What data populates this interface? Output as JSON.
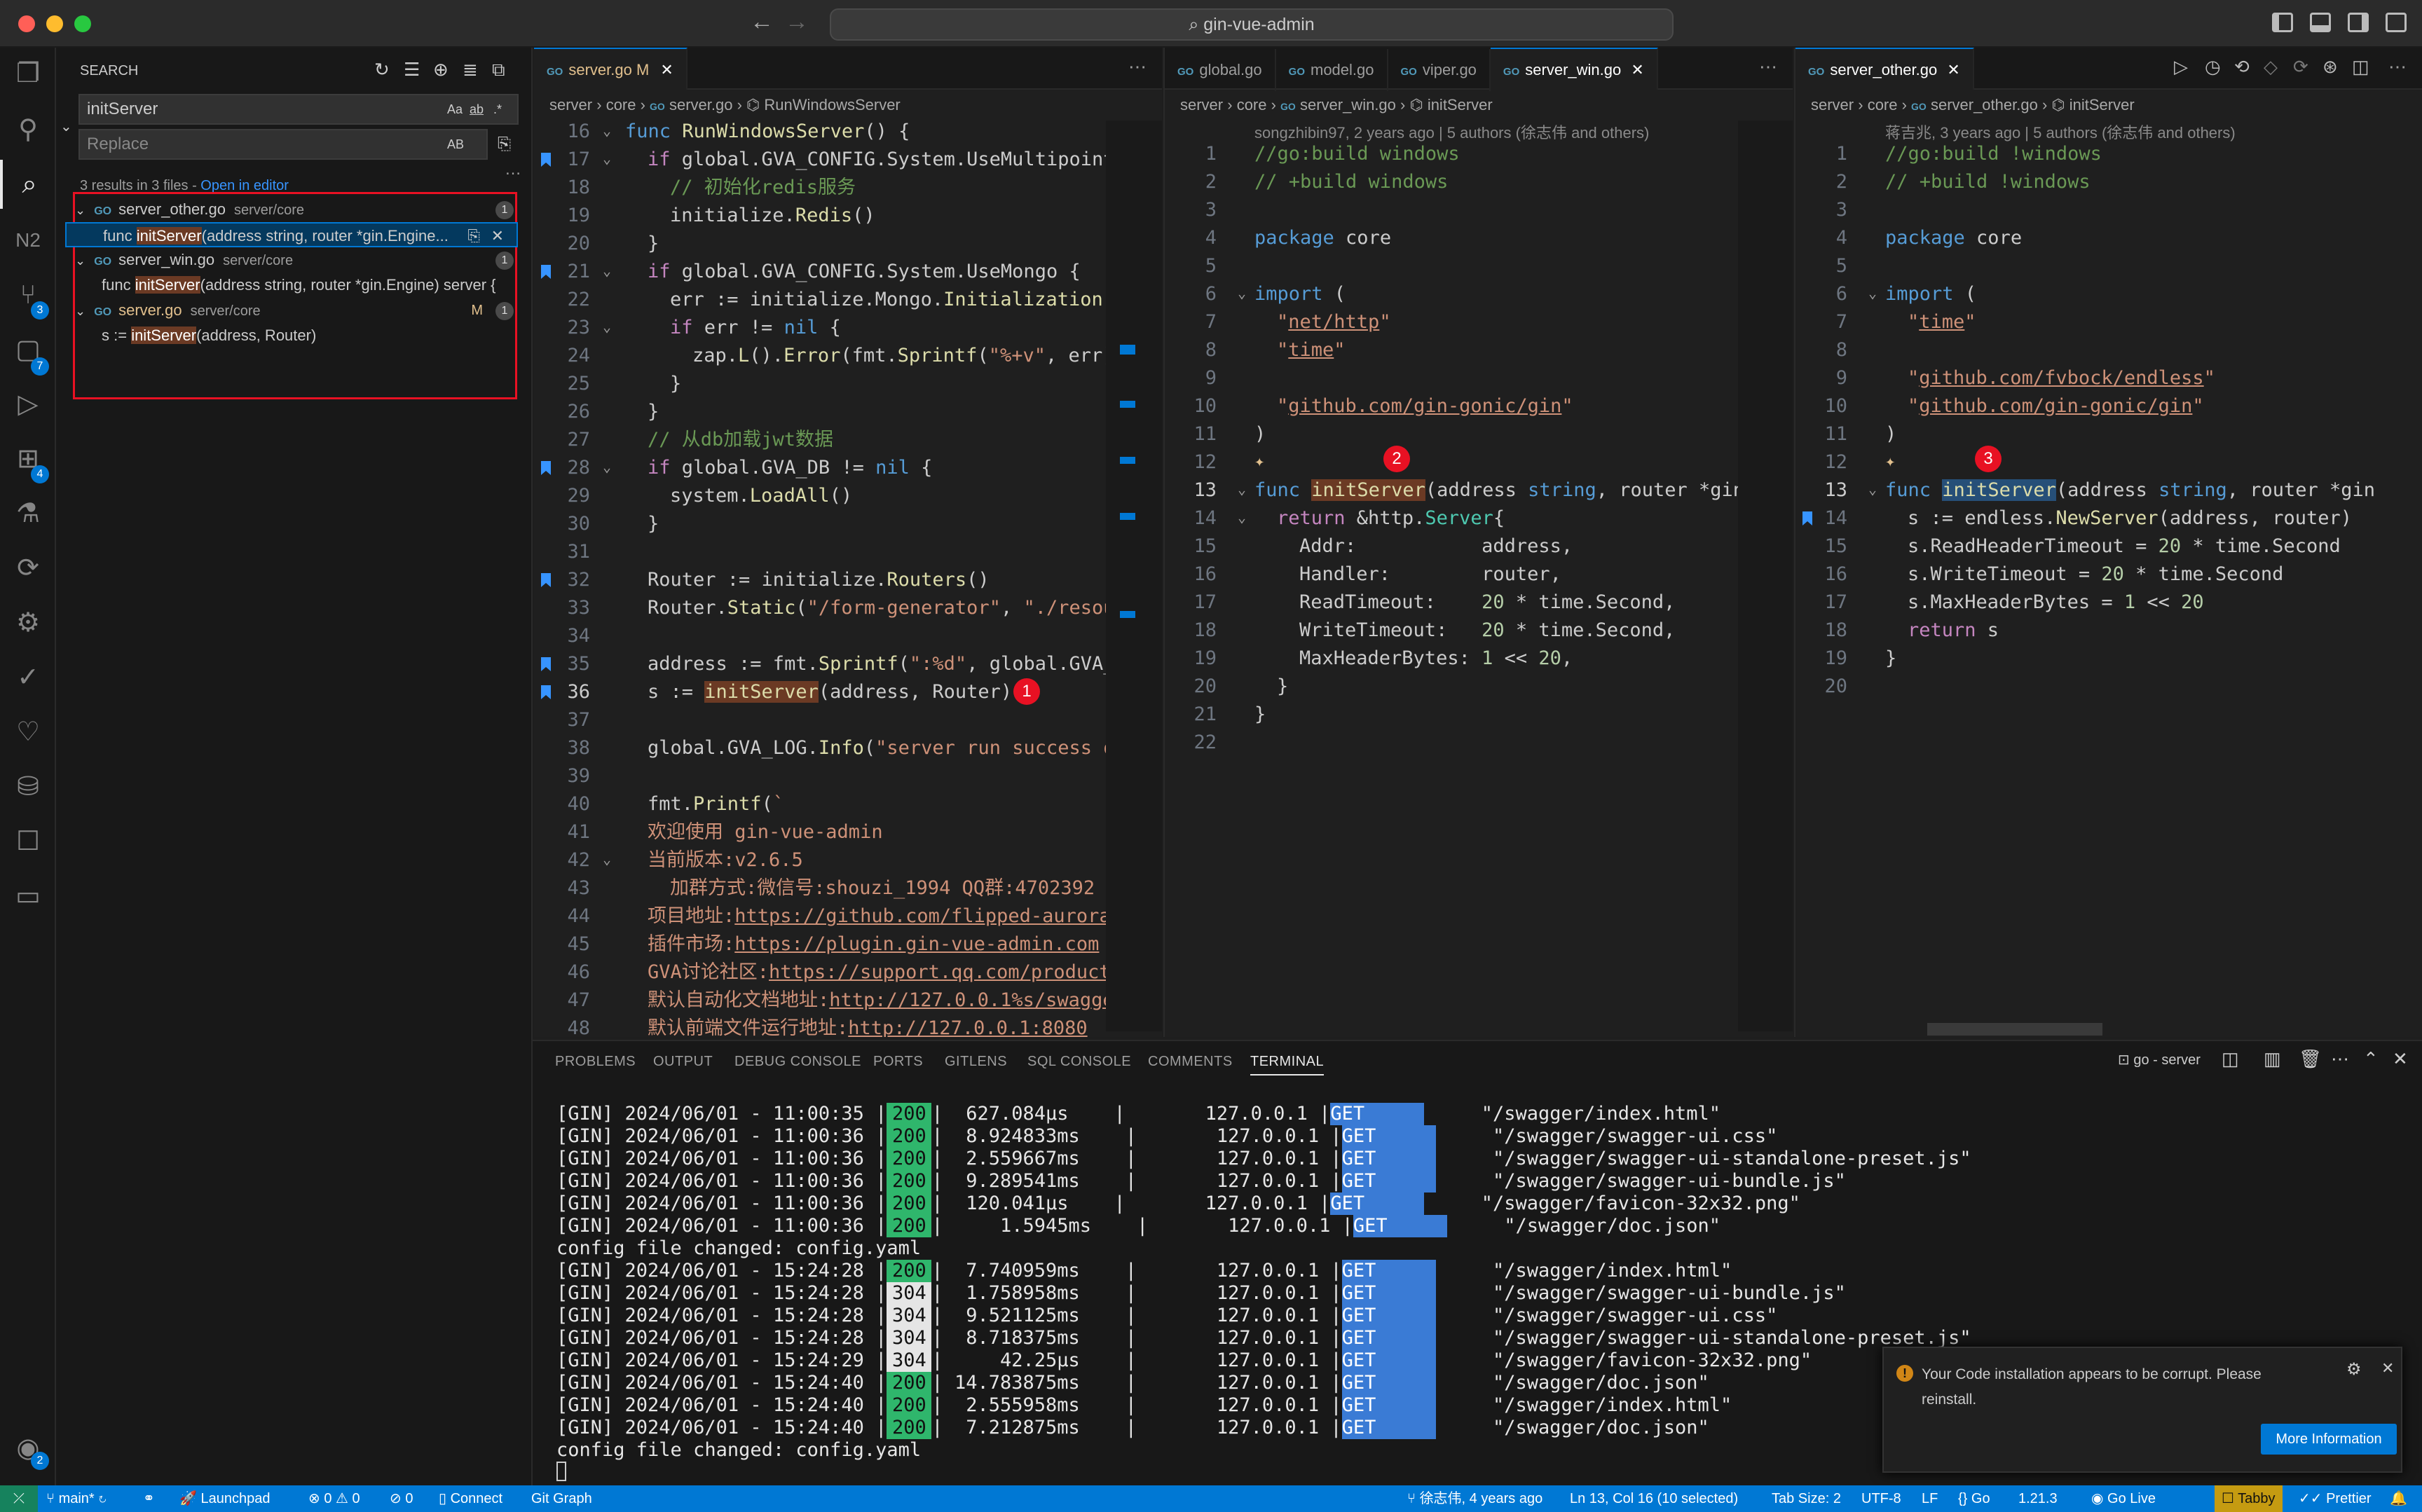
{
  "window": {
    "title": "gin-vue-admin"
  },
  "activity_badges": {
    "scm": "3",
    "run": "7",
    "ext": "4",
    "accounts": "2"
  },
  "search": {
    "header": "SEARCH",
    "query": "initServer",
    "replace_placeholder": "Replace",
    "case_opt": "Aa",
    "word_opt": "ab",
    "regex_opt": ".*",
    "preserve_case": "AB",
    "summary": "3 results in 3 files - ",
    "open_in_editor": "Open in editor",
    "files": [
      {
        "name": "server_other.go",
        "path": "server/core",
        "count": "1",
        "match_pre": "func ",
        "match": "initServer",
        "match_post": "(address string, router *gin.Engine..."
      },
      {
        "name": "server_win.go",
        "path": "server/core",
        "count": "1",
        "match_pre": "func ",
        "match": "initServer",
        "match_post": "(address string, router *gin.Engine) server {"
      },
      {
        "name": "server.go",
        "path": "server/core",
        "count": "1",
        "modified": "M",
        "match_pre": "s := ",
        "match": "initServer",
        "match_post": "(address, Router)"
      }
    ]
  },
  "editor1": {
    "tab": "server.go",
    "tab_badge": "M",
    "crumbs": [
      "server",
      "core",
      "server.go",
      "RunWindowsServer"
    ],
    "marker": "1"
  },
  "editor2": {
    "tabs": [
      "global.go",
      "model.go",
      "viper.go",
      "server_win.go"
    ],
    "crumbs": [
      "server",
      "core",
      "server_win.go",
      "initServer"
    ],
    "blame": "songzhibin97, 2 years ago | 5 authors (徐志伟 and others)",
    "marker": "2"
  },
  "editor3": {
    "tab": "server_other.go",
    "crumbs": [
      "server",
      "core",
      "server_other.go",
      "initServer"
    ],
    "blame": "蒋吉兆, 3 years ago | 5 authors (徐志伟 and others)",
    "marker": "3"
  },
  "panel": {
    "tabs": [
      "PROBLEMS",
      "OUTPUT",
      "DEBUG CONSOLE",
      "PORTS",
      "GITLENS",
      "SQL CONSOLE",
      "COMMENTS",
      "TERMINAL"
    ],
    "terminal_name": "go - server",
    "lines": [
      {
        "t": "[GIN] 2024/06/01 - 11:00:35",
        "s": "200",
        "d": "  627.084µs",
        "ip": "127.0.0.1",
        "m": "GET",
        "p": "\"/swagger/index.html\""
      },
      {
        "t": "[GIN] 2024/06/01 - 11:00:36",
        "s": "200",
        "d": "  8.924833ms",
        "ip": "127.0.0.1",
        "m": "GET",
        "p": "\"/swagger/swagger-ui.css\""
      },
      {
        "t": "[GIN] 2024/06/01 - 11:00:36",
        "s": "200",
        "d": "  2.559667ms",
        "ip": "127.0.0.1",
        "m": "GET",
        "p": "\"/swagger/swagger-ui-standalone-preset.js\""
      },
      {
        "t": "[GIN] 2024/06/01 - 11:00:36",
        "s": "200",
        "d": "  9.289541ms",
        "ip": "127.0.0.1",
        "m": "GET",
        "p": "\"/swagger/swagger-ui-bundle.js\""
      },
      {
        "t": "[GIN] 2024/06/01 - 11:00:36",
        "s": "200",
        "d": "  120.041µs",
        "ip": "127.0.0.1",
        "m": "GET",
        "p": "\"/swagger/favicon-32x32.png\""
      },
      {
        "t": "[GIN] 2024/06/01 - 11:00:36",
        "s": "200",
        "d": "     1.5945ms",
        "ip": "127.0.0.1",
        "m": "GET",
        "p": "\"/swagger/doc.json\""
      },
      {
        "plain": "config file changed: config.yaml"
      },
      {
        "t": "[GIN] 2024/06/01 - 15:24:28",
        "s": "200",
        "d": "  7.740959ms",
        "ip": "127.0.0.1",
        "m": "GET",
        "p": "\"/swagger/index.html\""
      },
      {
        "t": "[GIN] 2024/06/01 - 15:24:28",
        "s": "304",
        "d": "  1.758958ms",
        "ip": "127.0.0.1",
        "m": "GET",
        "p": "\"/swagger/swagger-ui-bundle.js\""
      },
      {
        "t": "[GIN] 2024/06/01 - 15:24:28",
        "s": "304",
        "d": "  9.521125ms",
        "ip": "127.0.0.1",
        "m": "GET",
        "p": "\"/swagger/swagger-ui.css\""
      },
      {
        "t": "[GIN] 2024/06/01 - 15:24:28",
        "s": "304",
        "d": "  8.718375ms",
        "ip": "127.0.0.1",
        "m": "GET",
        "p": "\"/swagger/swagger-ui-standalone-preset.js\""
      },
      {
        "t": "[GIN] 2024/06/01 - 15:24:29",
        "s": "304",
        "d": "     42.25µs",
        "ip": "127.0.0.1",
        "m": "GET",
        "p": "\"/swagger/favicon-32x32.png\""
      },
      {
        "t": "[GIN] 2024/06/01 - 15:24:40",
        "s": "200",
        "d": " 14.783875ms",
        "ip": "127.0.0.1",
        "m": "GET",
        "p": "\"/swagger/doc.json\""
      },
      {
        "t": "[GIN] 2024/06/01 - 15:24:40",
        "s": "200",
        "d": "  2.555958ms",
        "ip": "127.0.0.1",
        "m": "GET",
        "p": "\"/swagger/index.html\""
      },
      {
        "t": "[GIN] 2024/06/01 - 15:24:40",
        "s": "200",
        "d": "  7.212875ms",
        "ip": "127.0.0.1",
        "m": "GET",
        "p": "\"/swagger/doc.json\""
      },
      {
        "plain": "config file changed: config.yaml"
      }
    ]
  },
  "notification": {
    "message": "Your Code installation appears to be corrupt. Please reinstall.",
    "button": "More Information"
  },
  "statusbar": {
    "branch": "main*",
    "launchpad": "Launchpad",
    "problems": "0 ⚠ 0",
    "ports": "0",
    "connect": "Connect",
    "git_graph": "Git Graph",
    "blame": "徐志伟, 4 years ago",
    "position": "Ln 13, Col 16 (10 selected)",
    "tab_size": "Tab Size: 2",
    "encoding": "UTF-8",
    "eol": "LF",
    "language": "Go",
    "go_version": "1.21.3",
    "go_live": "Go Live",
    "tabby": "Tabby",
    "prettier": "Prettier"
  }
}
